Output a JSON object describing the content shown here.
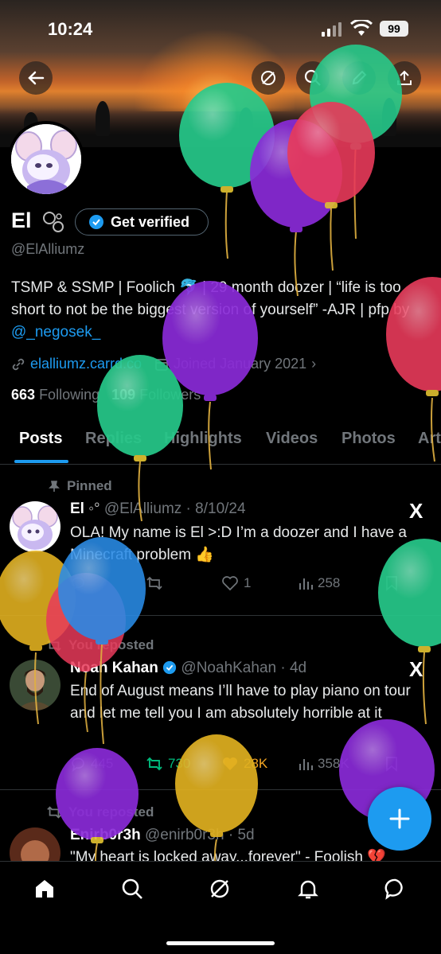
{
  "status_bar": {
    "time": "10:24",
    "battery": "99"
  },
  "profile": {
    "name": "El",
    "get_verified": "Get verified",
    "handle": "@ElAlliumz",
    "bio_part1": "TSMP & SSMP | Foolich 🐬 | 29 month doozer | “life is too short to not be the biggest version of yourself” -AJR | pfp by ",
    "bio_link": "@_negosek_",
    "website": "elalliumz.carrd.co",
    "joined": "Joined January 2021",
    "following_count": "663",
    "following_label": "Following",
    "followers_count": "109",
    "followers_label": "Followers"
  },
  "tabs": [
    "Posts",
    "Replies",
    "Highlights",
    "Videos",
    "Photos",
    "Art"
  ],
  "tweets": [
    {
      "label": "Pinned",
      "name": "El",
      "handle": "@ElAlliumz",
      "date": "8/10/24",
      "text": "OLA! My name is El >:D I’m a doozer and I have a Minecraft problem 👍",
      "replies": "",
      "reposts": "",
      "likes": "1",
      "views": "258"
    },
    {
      "label": "You reposted",
      "name": "Noah Kahan",
      "handle": "@NoahKahan",
      "date": "4d",
      "text": "End of August means I’ll have to play piano on tour and let me tell you I am absolutely horrible at it",
      "replies": "445",
      "reposts": "730",
      "likes": "28K",
      "views": "358K"
    },
    {
      "label": "You reposted",
      "name": "Enirb0r3h",
      "handle": "@enirb0r3h",
      "date": "5d",
      "text": "\"My heart is locked away...forever\" - Foolish 💔"
    }
  ],
  "colors": {
    "accent": "#1d9bf0",
    "repost_green": "#00ba7c",
    "like_orange": "#f4a623"
  },
  "icons": [
    "back-arrow-icon",
    "grok-icon",
    "search-icon",
    "edit-icon",
    "share-icon",
    "verified-badge-icon",
    "link-icon",
    "calendar-icon",
    "pin-icon",
    "repost-icon",
    "reply-icon",
    "like-icon",
    "views-icon",
    "bookmark-icon",
    "x-logo-icon",
    "plus-icon",
    "home-icon",
    "notifications-icon",
    "messages-icon"
  ]
}
